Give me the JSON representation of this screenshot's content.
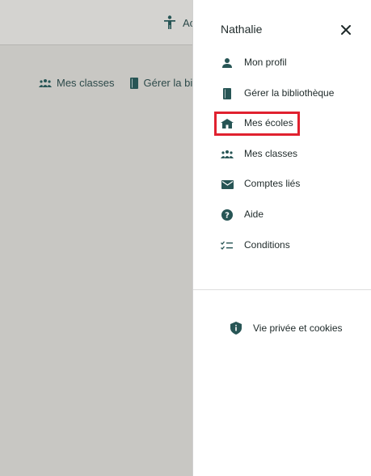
{
  "background": {
    "accessibility_label": "Ac",
    "nav": {
      "classes_label": "Mes classes",
      "library_label": "Gérer la bibl"
    }
  },
  "drawer": {
    "user_name": "Nathalie",
    "items": [
      {
        "label": "Mon profil",
        "icon": "person-icon"
      },
      {
        "label": "Gérer la bibliothèque",
        "icon": "book-icon"
      },
      {
        "label": "Mes écoles",
        "icon": "school-icon"
      },
      {
        "label": "Mes classes",
        "icon": "group-icon"
      },
      {
        "label": "Comptes liés",
        "icon": "mail-icon"
      },
      {
        "label": "Aide",
        "icon": "help-icon"
      },
      {
        "label": "Conditions",
        "icon": "checklist-icon"
      }
    ],
    "privacy_label": "Vie privée et cookies"
  },
  "colors": {
    "icon": "#275555",
    "highlight": "#e0212f",
    "overlay": "#c8c7c3"
  }
}
